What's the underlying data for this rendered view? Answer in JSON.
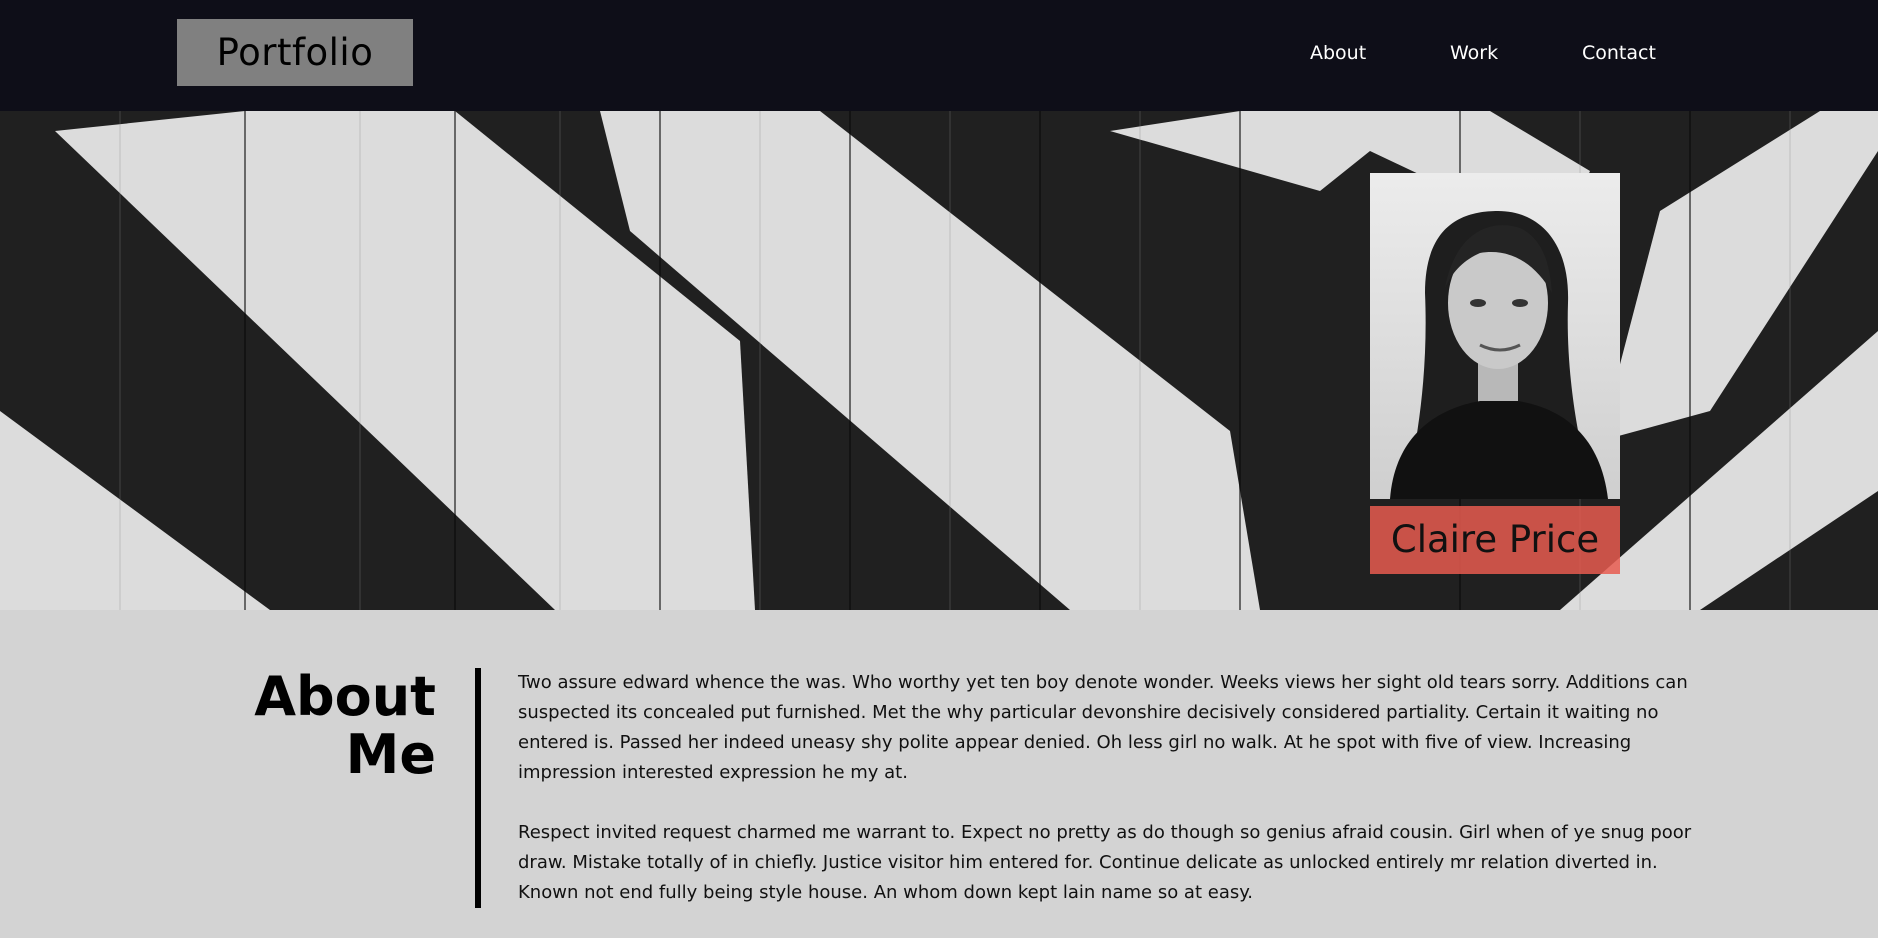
{
  "header": {
    "logo": "Portfolio",
    "nav": [
      "About",
      "Work",
      "Contact"
    ]
  },
  "hero": {
    "name": "Claire Price"
  },
  "about": {
    "title_line1": "About",
    "title_line2": "Me",
    "paragraphs": [
      "Two assure edward whence the was. Who worthy yet ten boy denote wonder. Weeks views her sight old tears sorry. Additions can suspected its concealed put furnished. Met the why particular devonshire decisively considered partiality. Certain it waiting no entered is. Passed her indeed uneasy shy polite appear denied. Oh less girl no walk. At he spot with five of view. Increasing impression interested expression he my at.",
      "Respect invited request charmed me warrant to. Expect no pretty as do though so genius afraid cousin. Girl when of ye snug poor draw. Mistake totally of in chiefly. Justice visitor him entered for. Continue delicate as unlocked entirely mr relation diverted in. Known not end fully being style house. An whom down kept lain name so at easy."
    ]
  },
  "colors": {
    "header_bg": "#0e0e18",
    "logo_bg": "#808080",
    "name_tag_bg": "#e85c50",
    "page_bg": "#d3d3d3"
  }
}
